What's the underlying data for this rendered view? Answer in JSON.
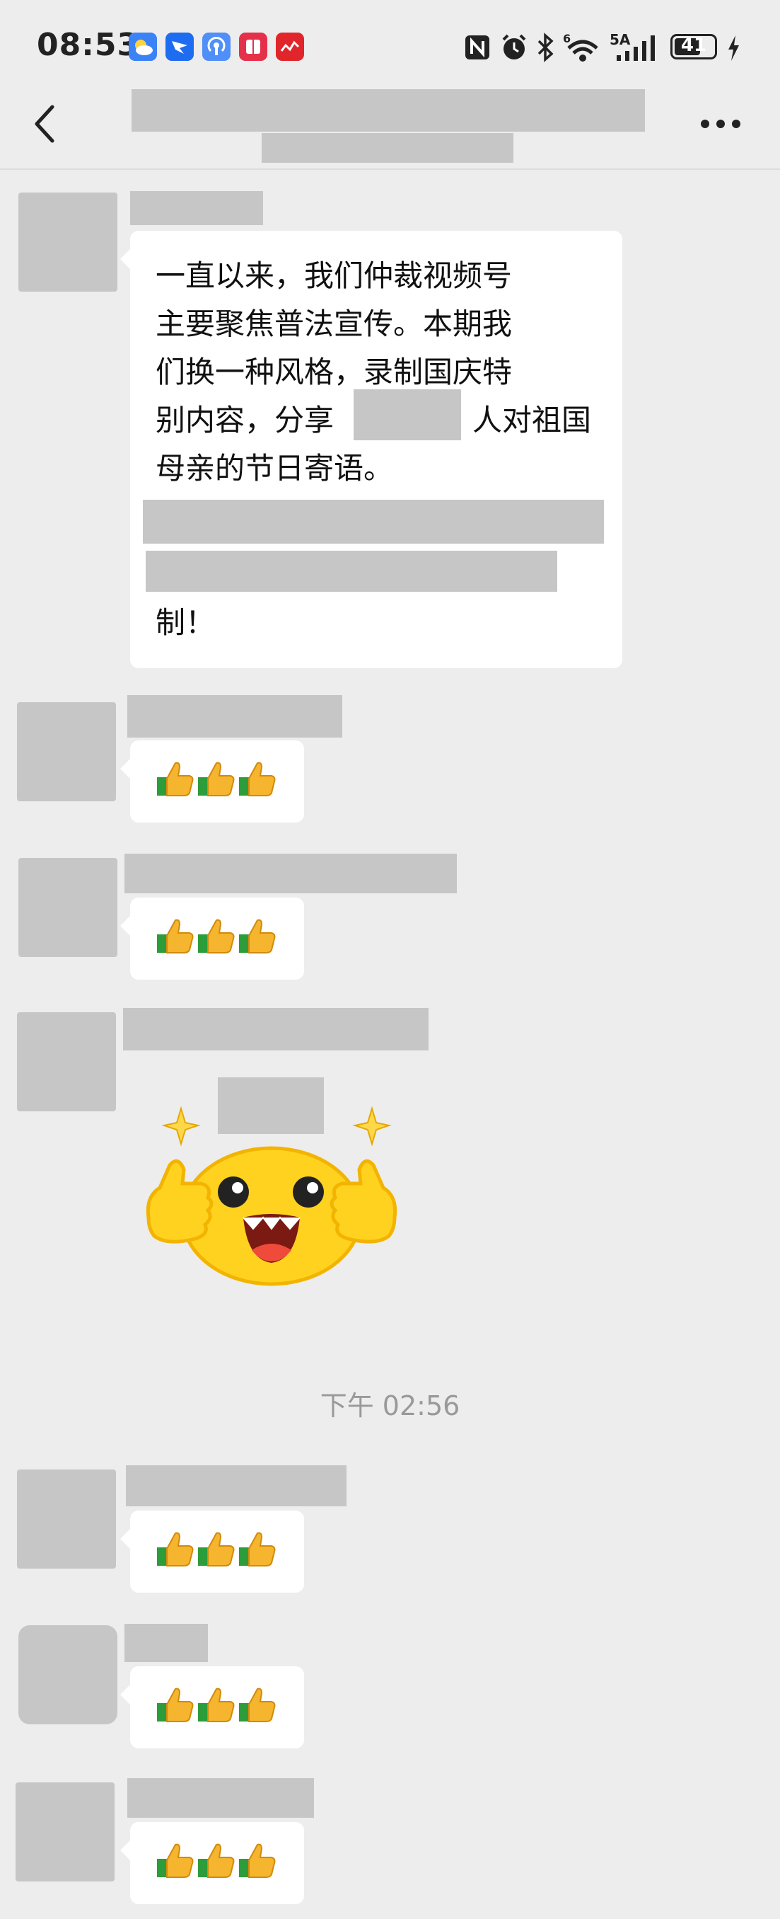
{
  "status_bar": {
    "time": "08:53",
    "app_icons": [
      {
        "name": "weather-app-icon",
        "color": "#3b82f6"
      },
      {
        "name": "dingtalk-app-icon",
        "color": "#1e6cf0"
      },
      {
        "name": "radio-app-icon",
        "color": "#4f8ff7"
      },
      {
        "name": "notes-app-icon",
        "color": "#e5304a"
      },
      {
        "name": "music-app-icon",
        "color": "#e0262b"
      }
    ],
    "network_label": "5A",
    "battery": "41"
  },
  "chat": {
    "messages": [
      {
        "type": "text",
        "lines": [
          "一直以来，我们仲裁视频号",
          "主要聚焦普法宣传。本期我",
          "们换一种风格，录制国庆特",
          "别内容，分享",
          "母亲的节日寄语。"
        ],
        "line4_tail": "人对祖国",
        "tail": "制！"
      },
      {
        "type": "thumbs",
        "emoji": "👍👍👍"
      },
      {
        "type": "thumbs",
        "emoji": "👍👍👍"
      },
      {
        "type": "sticker",
        "sticker_name": "thumbs-up-emoji-sticker"
      },
      {
        "type": "thumbs",
        "emoji": "👍👍👍"
      },
      {
        "type": "thumbs",
        "emoji": "👍👍👍"
      },
      {
        "type": "thumbs",
        "emoji": "👍👍👍"
      }
    ],
    "timestamp": "下午 02:56"
  },
  "colors": {
    "background": "#ededed",
    "bubble": "#ffffff",
    "redaction": "#c6c6c6",
    "timestamp": "#999999"
  }
}
